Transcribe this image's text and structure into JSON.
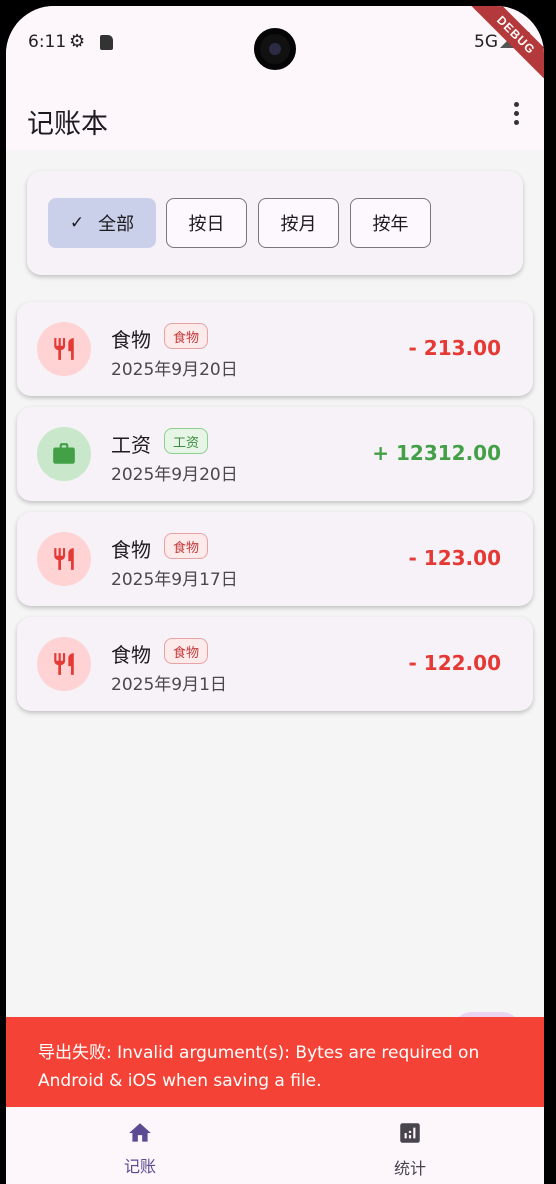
{
  "status_bar": {
    "time": "6:11",
    "network": "5G",
    "icons": [
      "settings-icon",
      "sd-card-icon",
      "signal-icon",
      "battery-icon"
    ]
  },
  "debug_banner": "DEBUG",
  "app_bar": {
    "title": "记账本",
    "menu_icon": "more-vert-icon"
  },
  "filters": {
    "options": [
      {
        "label": "全部",
        "selected": true
      },
      {
        "label": "按日",
        "selected": false
      },
      {
        "label": "按月",
        "selected": false
      },
      {
        "label": "按年",
        "selected": false
      }
    ]
  },
  "transactions": [
    {
      "category": "食物",
      "tag": "食物",
      "date": "2025年9月20日",
      "amount": "- 213.00",
      "type": "expense",
      "icon": "restaurant-icon"
    },
    {
      "category": "工资",
      "tag": "工资",
      "date": "2025年9月20日",
      "amount": "+ 12312.00",
      "type": "income",
      "icon": "briefcase-icon"
    },
    {
      "category": "食物",
      "tag": "食物",
      "date": "2025年9月17日",
      "amount": "- 123.00",
      "type": "expense",
      "icon": "restaurant-icon"
    },
    {
      "category": "食物",
      "tag": "食物",
      "date": "2025年9月1日",
      "amount": "- 122.00",
      "type": "expense",
      "icon": "restaurant-icon"
    }
  ],
  "snackbar": {
    "message": "导出失败: Invalid argument(s): Bytes are required on Android & iOS when saving a file."
  },
  "bottom_nav": {
    "items": [
      {
        "label": "记账",
        "icon": "home-icon",
        "active": true
      },
      {
        "label": "统计",
        "icon": "bar-chart-icon",
        "active": false
      }
    ]
  },
  "colors": {
    "expense": "#e53935",
    "income": "#43a047",
    "snackbar": "#f44336",
    "primary": "#5c4b93"
  }
}
